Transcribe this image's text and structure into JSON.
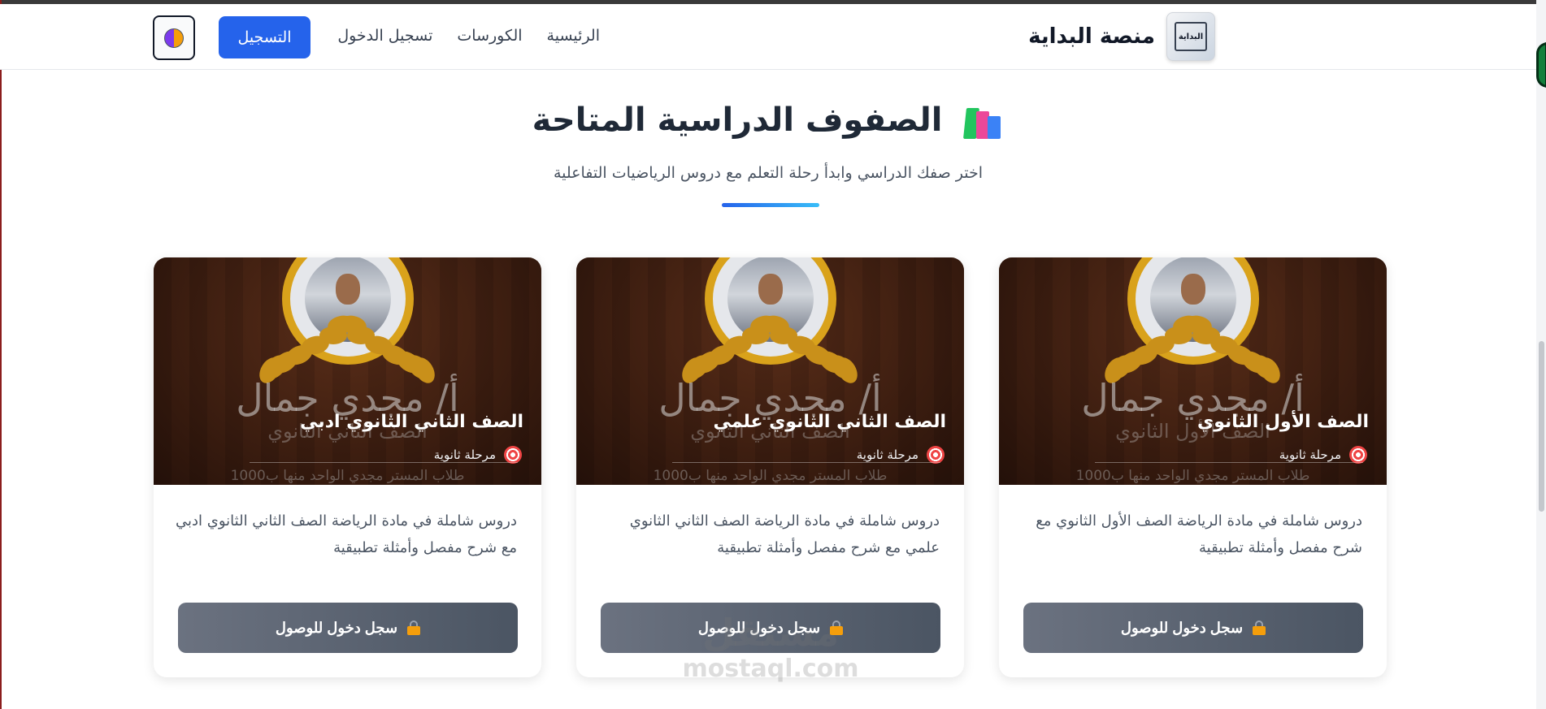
{
  "nav": {
    "brand_name": "منصة البداية",
    "brand_logo_text": "البداية",
    "links": [
      "الرئيسية",
      "الكورسات",
      "تسجيل الدخول"
    ],
    "register_label": "التسجيل"
  },
  "section": {
    "title": "الصفوف الدراسية المتاحة",
    "subtitle": "اختر صفك الدراسي وابدأ رحلة التعلم مع دروس الرياضيات التفاعلية"
  },
  "card_watermark": {
    "teacher": "أ/ مجدي جمال",
    "line": "طلاب المستر مجدي الواحد منها ب1000"
  },
  "cards": [
    {
      "watermark_sub": "الصف الأول الثانوي",
      "title": "الصف الأول الثانوي",
      "stage": "مرحلة ثانوية",
      "description": "دروس شاملة في مادة الرياضة الصف الأول الثانوي مع شرح مفصل وأمثلة تطبيقية",
      "button_label": "سجل دخول للوصول"
    },
    {
      "watermark_sub": "الصف الثاني الثانوي",
      "title": "الصف الثاني الثانوي علمي",
      "stage": "مرحلة ثانوية",
      "description": "دروس شاملة في مادة الرياضة الصف الثاني الثانوي علمي مع شرح مفصل وأمثلة تطبيقية",
      "button_label": "سجل دخول للوصول"
    },
    {
      "watermark_sub": "الصف الثاني الثانوي",
      "title": "الصف الثاني الثانوي ادبي",
      "stage": "مرحلة ثانوية",
      "description": "دروس شاملة في مادة الرياضة الصف الثاني الثانوي ادبي مع شرح مفصل وأمثلة تطبيقية",
      "button_label": "سجل دخول للوصول"
    }
  ],
  "site_watermark": {
    "arabic": "مستقل",
    "latin": "mostaql.com"
  },
  "colors": {
    "primary": "#2563eb",
    "card_button": "#4b5563",
    "accent_gold": "#d9a21b"
  },
  "icons": {
    "theme": "theme-toggle-icon",
    "section": "books-icon",
    "stage": "target-icon",
    "button": "lock-icon"
  }
}
